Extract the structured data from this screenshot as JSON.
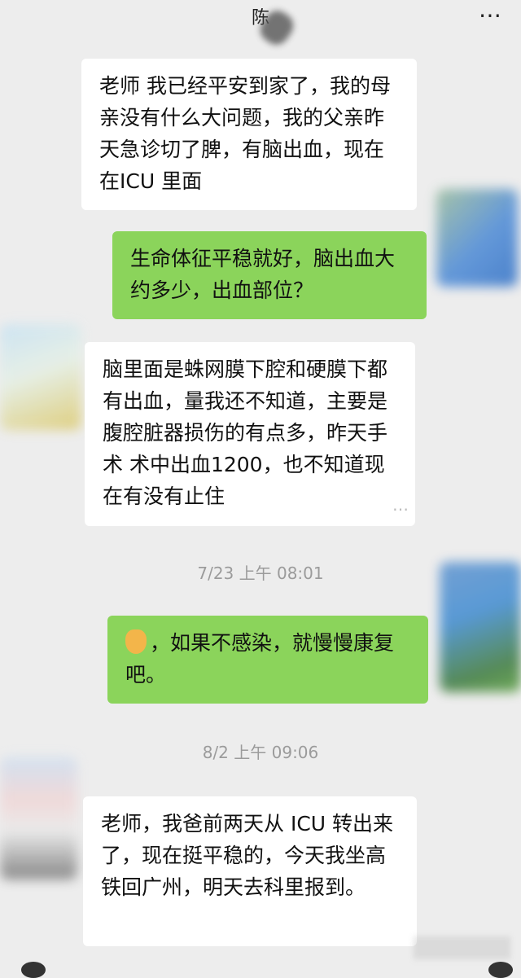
{
  "header": {
    "title": "陈",
    "more_icon": "⋯"
  },
  "messages": [
    {
      "side": "in",
      "text": "老师 我已经平安到家了，我的母亲没有什么大问题，我的父亲昨天急诊切了脾，有脑出血，现在在ICU 里面"
    },
    {
      "side": "out",
      "text": "生命体征平稳就好，脑出血大约多少，出血部位？"
    },
    {
      "side": "in",
      "text": "脑里面是蛛网膜下腔和硬膜下都有出血，量我还不知道，主要是腹腔脏器损伤的有点多，昨天手术 术中出血1200，也不知道现在有没有止住"
    },
    {
      "side": "out",
      "text": "，如果不感染，就慢慢康复吧。",
      "emoji": "ok-hand-emoji"
    },
    {
      "side": "in",
      "text": "老师，我爸前两天从 ICU 转出来了，现在挺平稳的，今天我坐高铁回广州，明天去科里报到。"
    }
  ],
  "timestamps": [
    "7/23 上午 08:01",
    "8/2 上午 09:06"
  ],
  "colors": {
    "background": "#ededed",
    "incoming": "#ffffff",
    "outgoing": "#8bd45b",
    "timestamp": "#9b9b9b"
  }
}
